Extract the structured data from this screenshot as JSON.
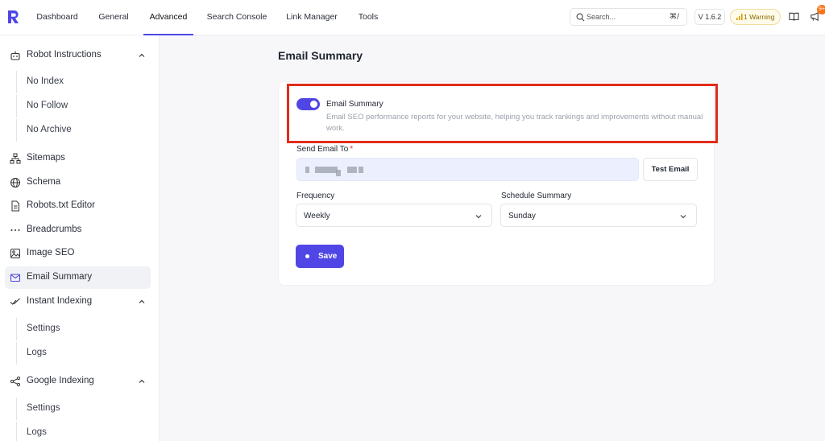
{
  "nav": {
    "tabs": [
      {
        "label": "Dashboard"
      },
      {
        "label": "General"
      },
      {
        "label": "Advanced"
      },
      {
        "label": "Search Console"
      },
      {
        "label": "Link Manager"
      },
      {
        "label": "Tools"
      }
    ],
    "active": "Advanced",
    "search_placeholder": "Search...",
    "search_shortcut": "⌘/",
    "version": "V 1.6.2",
    "warning": "1 Warning",
    "notification_count": "9+"
  },
  "sidebar": {
    "items": [
      {
        "label": "Robot Instructions",
        "icon": "robot-icon",
        "expanded": true
      },
      {
        "label": "No Index"
      },
      {
        "label": "No Follow"
      },
      {
        "label": "No Archive"
      },
      {
        "label": "Sitemaps",
        "icon": "sitemap-icon"
      },
      {
        "label": "Schema",
        "icon": "globe-icon"
      },
      {
        "label": "Robots.txt Editor",
        "icon": "document-icon"
      },
      {
        "label": "Breadcrumbs",
        "icon": "ellipsis-icon"
      },
      {
        "label": "Image SEO",
        "icon": "image-icon"
      },
      {
        "label": "Email Summary",
        "icon": "mail-icon",
        "active": true
      },
      {
        "label": "Instant Indexing",
        "icon": "double-check-icon",
        "expanded": true
      },
      {
        "label": "Settings"
      },
      {
        "label": "Logs"
      },
      {
        "label": "Google Indexing",
        "icon": "google-indexing-icon",
        "expanded": true
      },
      {
        "label": "Settings"
      },
      {
        "label": "Logs"
      }
    ]
  },
  "main": {
    "title": "Email Summary",
    "toggle": {
      "label": "Email Summary",
      "enabled": true,
      "description": "Email SEO performance reports for your website, helping you track rankings and improvements without manual work."
    },
    "send_email_label": "Send Email To",
    "required_mark": "*",
    "test_email_label": "Test Email",
    "frequency_label": "Frequency",
    "frequency_value": "Weekly",
    "schedule_label": "Schedule Summary",
    "schedule_value": "Sunday",
    "save_label": "Save"
  },
  "colors": {
    "accent": "#4f46e5",
    "highlight": "#e02d1b",
    "warning": "#8a6a00"
  }
}
